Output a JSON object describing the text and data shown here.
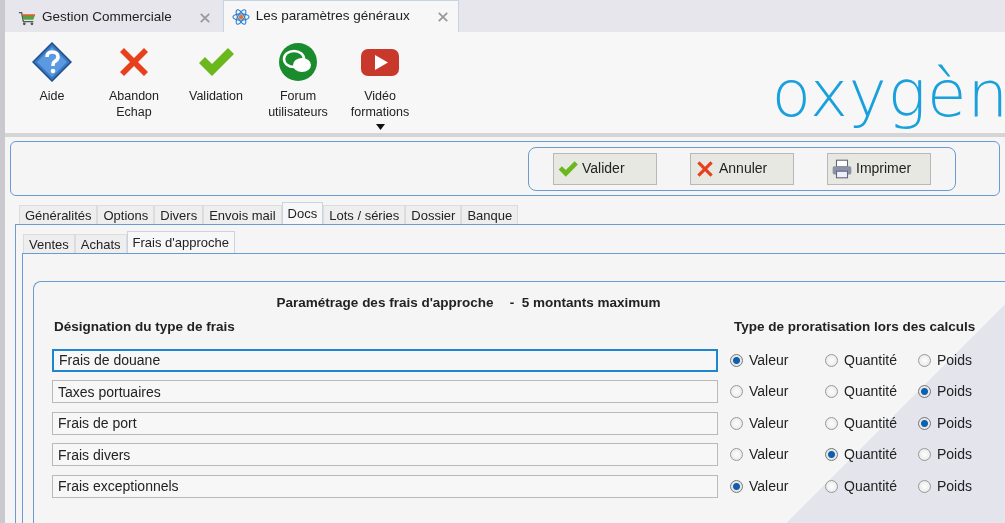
{
  "app_tabs": [
    {
      "label": "Gestion Commerciale",
      "selected": false
    },
    {
      "label": "Les paramètres généraux",
      "selected": true
    }
  ],
  "toolbar": [
    {
      "lines": [
        "Aide"
      ],
      "dropdown": false
    },
    {
      "lines": [
        "Abandon",
        "Echap"
      ],
      "dropdown": false
    },
    {
      "lines": [
        "Validation"
      ],
      "dropdown": false
    },
    {
      "lines": [
        "Forum",
        "utilisateurs"
      ],
      "dropdown": false
    },
    {
      "lines": [
        "Vidéo",
        "formations"
      ],
      "dropdown": true
    }
  ],
  "logo": "oxygèn",
  "action_buttons": [
    {
      "label": "Valider"
    },
    {
      "label": "Annuler"
    },
    {
      "label": "Imprimer"
    }
  ],
  "tabs": [
    {
      "label": "Généralités",
      "selected": false
    },
    {
      "label": "Options",
      "selected": false
    },
    {
      "label": "Divers",
      "selected": false
    },
    {
      "label": "Envois mail",
      "selected": false
    },
    {
      "label": "Docs",
      "selected": true
    },
    {
      "label": "Lots / séries",
      "selected": false
    },
    {
      "label": "Dossier",
      "selected": false
    },
    {
      "label": "Banque",
      "selected": false
    }
  ],
  "subtabs": [
    {
      "label": "Ventes",
      "selected": false
    },
    {
      "label": "Achats",
      "selected": false
    },
    {
      "label": "Frais d'approche",
      "selected": true
    }
  ],
  "section": {
    "title": "Paramétrage des frais d'approche",
    "subtitle": "-  5 montants maximum",
    "column_headers": [
      "Désignation du type de frais",
      "Type de proratisation lors des calculs"
    ],
    "rows": [
      {
        "value": "Frais de douane",
        "focused": true,
        "options": [
          {
            "label": "Valeur",
            "selected": true
          },
          {
            "label": "Quantité",
            "selected": false
          },
          {
            "label": "Poids",
            "selected": false
          }
        ]
      },
      {
        "value": "Taxes portuaires",
        "focused": false,
        "options": [
          {
            "label": "Valeur",
            "selected": false
          },
          {
            "label": "Quantité",
            "selected": false
          },
          {
            "label": "Poids",
            "selected": true
          }
        ]
      },
      {
        "value": "Frais de port",
        "focused": false,
        "options": [
          {
            "label": "Valeur",
            "selected": false
          },
          {
            "label": "Quantité",
            "selected": false
          },
          {
            "label": "Poids",
            "selected": true
          }
        ]
      },
      {
        "value": "Frais divers",
        "focused": false,
        "options": [
          {
            "label": "Valeur",
            "selected": false
          },
          {
            "label": "Quantité",
            "selected": true
          },
          {
            "label": "Poids",
            "selected": false
          }
        ]
      },
      {
        "value": "Frais exceptionnels",
        "focused": false,
        "options": [
          {
            "label": "Valeur",
            "selected": true
          },
          {
            "label": "Quantité",
            "selected": false
          },
          {
            "label": "Poids",
            "selected": false
          }
        ]
      }
    ]
  }
}
